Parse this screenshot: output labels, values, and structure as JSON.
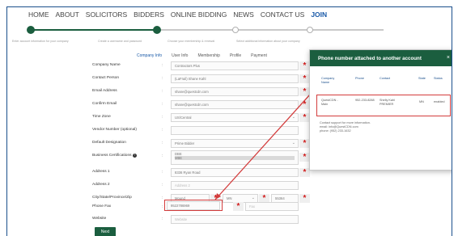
{
  "nav": {
    "items": [
      {
        "label": "HOME",
        "active": false
      },
      {
        "label": "ABOUT",
        "active": false
      },
      {
        "label": "SOLICITORS",
        "active": false
      },
      {
        "label": "BIDDERS",
        "active": false
      },
      {
        "label": "ONLINE BIDDING",
        "active": false
      },
      {
        "label": "NEWS",
        "active": false
      },
      {
        "label": "CONTACT US",
        "active": false
      },
      {
        "label": "JOIN",
        "active": true
      }
    ]
  },
  "steps": [
    "Enter account information for your company",
    "Create a username and password",
    "Choose your membership & renewal",
    "Select additional information about your company"
  ],
  "tabs": [
    {
      "label": "Company Info",
      "active": true
    },
    {
      "label": "User Info",
      "active": false
    },
    {
      "label": "Membership",
      "active": false
    },
    {
      "label": "Profile",
      "active": false
    },
    {
      "label": "Payment",
      "active": false
    }
  ],
  "form": {
    "company_name": {
      "label": "Company Name",
      "value": "Contractors Plus"
    },
    "contact_person": {
      "label": "Contact Person",
      "value": "(LaFrail) Shane Kahl"
    },
    "email": {
      "label": "Email Address",
      "value": "shane@questcdn.com"
    },
    "confirm_email": {
      "label": "Confirm Email",
      "value": "shane@questcdn.com"
    },
    "time_zone": {
      "label": "Time Zone",
      "value": "US/Central"
    },
    "vendor_number": {
      "label": "Vendor Number (optional)",
      "value": ""
    },
    "default_designation": {
      "label": "Default Designation",
      "value": "Prime Bidder"
    },
    "business_certifications": {
      "label": "Business Certifications",
      "options": [
        "DBE",
        "MBE"
      ]
    },
    "address1": {
      "label": "Address 1",
      "value": "8336 Ryan Road"
    },
    "address2": {
      "label": "Address 2",
      "placeholder": "Address 2"
    },
    "city_state_zip": {
      "label": "City/State/Province/Zip",
      "city": "Mound",
      "state": "MN",
      "zip": "55364"
    },
    "phone_fax": {
      "label": "Phone Fax",
      "phone": "9522786969",
      "fax_placeholder": "Fax"
    },
    "website": {
      "label": "Website",
      "placeholder": "Website"
    }
  },
  "next_button": "Next",
  "modal": {
    "title": "Phone number attached to another account",
    "close": "×",
    "headers": [
      "Company Name",
      "Phone",
      "Contact",
      "State",
      "Status"
    ],
    "row": [
      "QuestCDN - Main",
      "952-233-8288",
      "Shelly Kahl PREMIER",
      "MN",
      "enabled"
    ],
    "support": [
      "Contact support for more information.",
      "email: info@QuestCDN.com",
      "phone: (952) 233-1632"
    ]
  },
  "colors": {
    "accent_green": "#1b5e3f",
    "highlight_red": "#d33c3c",
    "link_blue": "#1a5aa8"
  }
}
